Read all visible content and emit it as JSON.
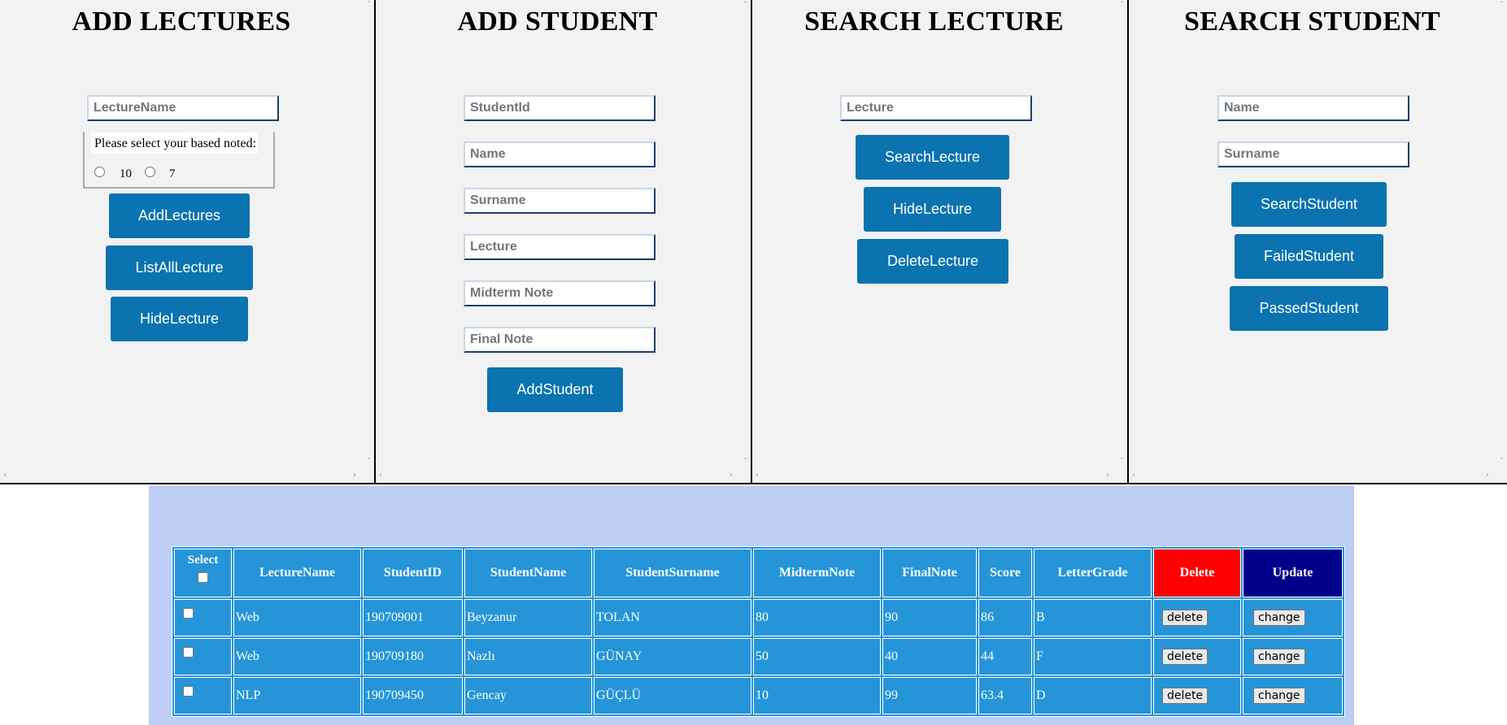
{
  "panels": {
    "add_lectures": {
      "title": "ADD LECTURES",
      "lecture_name_placeholder": "LectureName",
      "radio_legend": "Please select your based noted:",
      "radio_options": [
        "10",
        "7"
      ],
      "buttons": [
        "AddLectures",
        "ListAllLecture",
        "HideLecture"
      ]
    },
    "add_student": {
      "title": "ADD STUDENT",
      "placeholders": [
        "StudentId",
        "Name",
        "Surname",
        "Lecture",
        "Midterm Note",
        "Final Note"
      ],
      "button": "AddStudent"
    },
    "search_lecture": {
      "title": "SEARCH LECTURE",
      "placeholder": "Lecture",
      "buttons": [
        "SearchLecture",
        "HideLecture",
        "DeleteLecture"
      ]
    },
    "search_student": {
      "title": "SEARCH STUDENT",
      "placeholders": [
        "Name",
        "Surname"
      ],
      "buttons": [
        "SearchStudent",
        "FailedStudent",
        "PassedStudent"
      ]
    }
  },
  "table": {
    "select_header": "Select",
    "headers": [
      "LectureName",
      "StudentID",
      "StudentName",
      "StudentSurname",
      "MidtermNote",
      "FinalNote",
      "Score",
      "LetterGrade",
      "Delete",
      "Update"
    ],
    "rows": [
      [
        "Web",
        "190709001",
        "Beyzanur",
        "TOLAN",
        "80",
        "90",
        "86",
        "B"
      ],
      [
        "Web",
        "190709180",
        "Nazlı",
        "GÜNAY",
        "50",
        "40",
        "44",
        "F"
      ],
      [
        "NLP",
        "190709450",
        "Gencay",
        "GÜÇLÜ",
        "10",
        "99",
        "63.4",
        "D"
      ]
    ],
    "delete_label": "delete",
    "change_label": "change"
  },
  "colors": {
    "panel_bg": "#f2f2f2",
    "button_bg": "#0a73b0",
    "table_bg": "#2595d8",
    "bottom_bg": "#bdcdf4",
    "delete_header": "#ff0000",
    "update_header": "#00008b"
  }
}
